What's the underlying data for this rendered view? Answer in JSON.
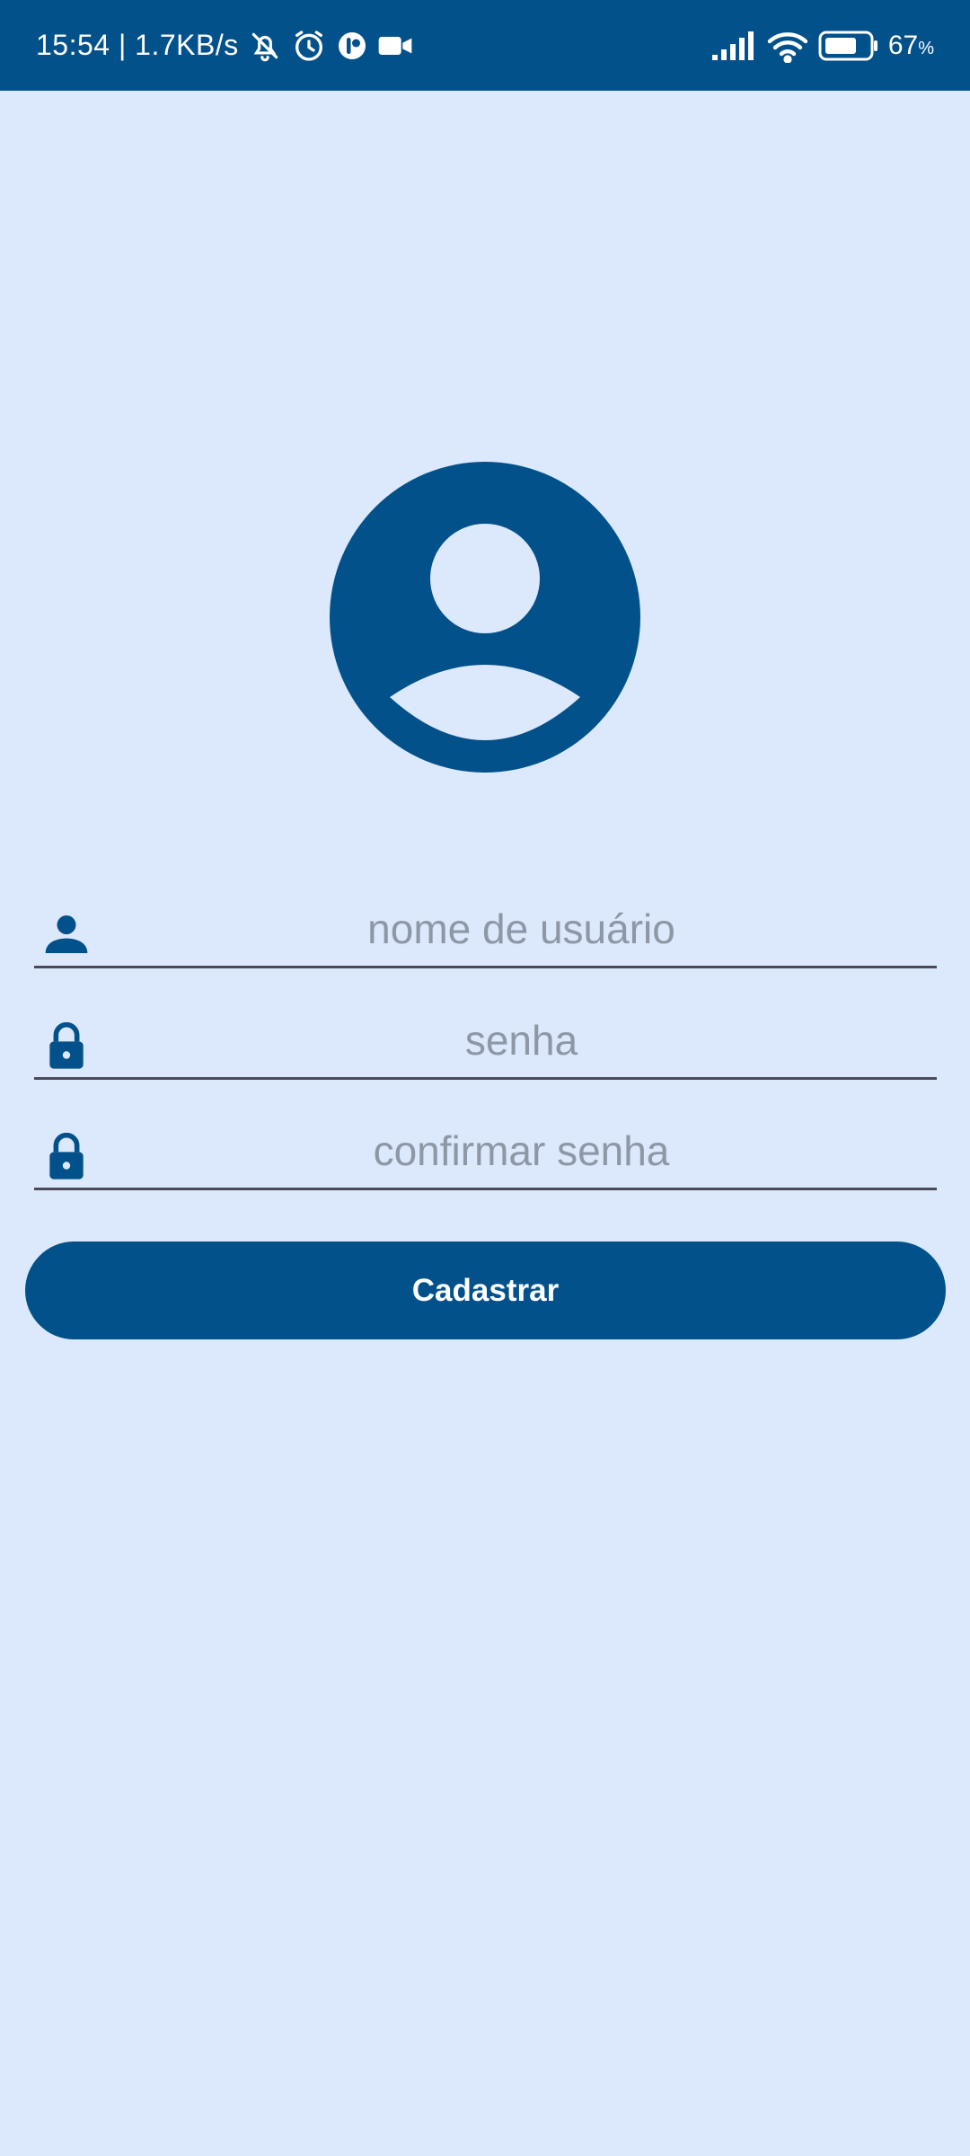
{
  "status_bar": {
    "time_speed": "15:54 | 1.7KB/s",
    "battery_value": "67",
    "battery_unit": "%"
  },
  "icons": {
    "status": [
      "bell-off-icon",
      "alarm-icon",
      "app-notification-icon",
      "video-camera-icon",
      "signal-icon",
      "wifi-icon",
      "battery-icon"
    ],
    "avatar": "account-circle-icon",
    "fields": [
      "person-icon",
      "lock-icon",
      "lock-icon"
    ]
  },
  "form": {
    "username_placeholder": "nome de usuário",
    "password_placeholder": "senha",
    "confirm_placeholder": "confirmar senha",
    "submit_label": "Cadastrar"
  },
  "colors": {
    "primary": "#03518a",
    "background": "#dce8fb",
    "placeholder": "#8e97a6",
    "underline": "#4a4a58"
  }
}
